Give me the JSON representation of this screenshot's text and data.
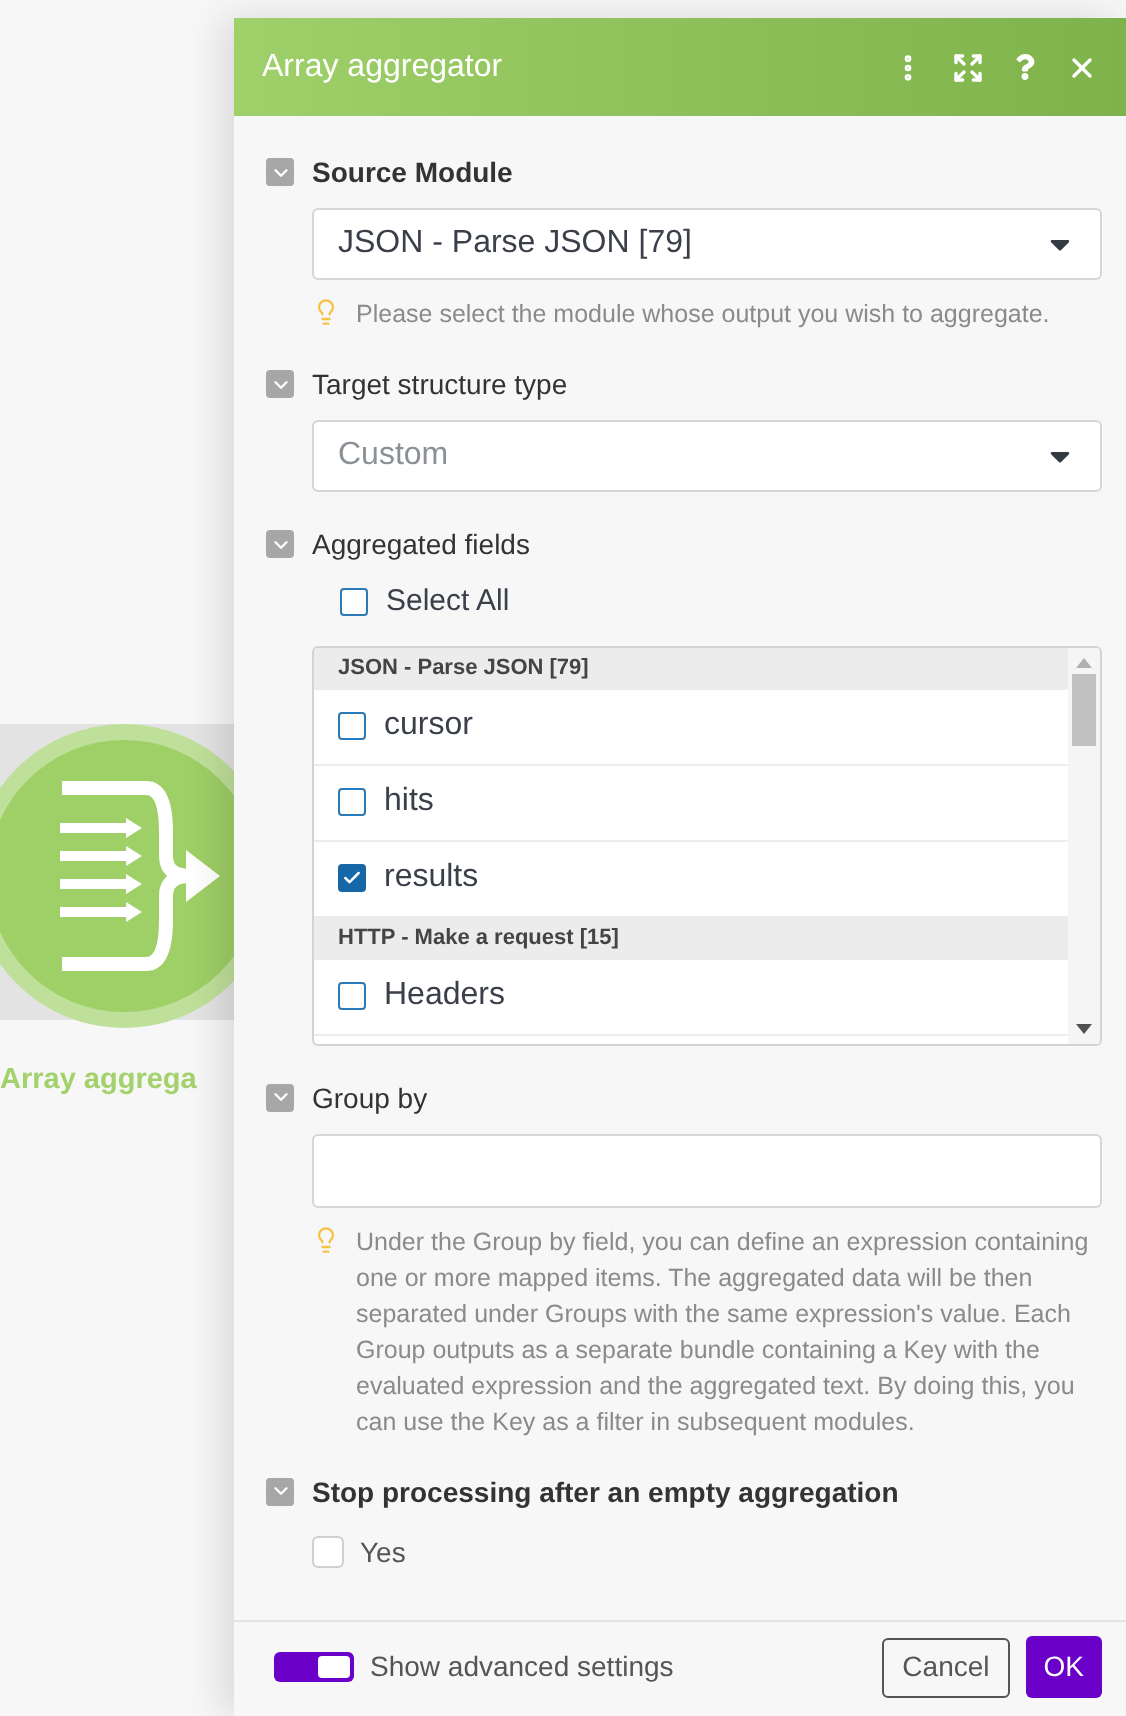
{
  "canvas": {
    "node": {
      "label": "Array aggrega"
    }
  },
  "panel": {
    "title": "Array aggregator",
    "sections": [
      {
        "kind": "select",
        "label": "Source Module",
        "required": true,
        "value": "JSON - Parse JSON [79]",
        "hint": "Please select the module whose output you wish to aggregate."
      },
      {
        "kind": "select",
        "label": "Target structure type",
        "required": false,
        "placeholder": "Custom"
      },
      {
        "kind": "checklist",
        "label": "Aggregated fields",
        "required": false,
        "select_all": {
          "label": "Select All",
          "checked": false
        },
        "groups": [
          {
            "title": "JSON - Parse JSON [79]",
            "items": [
              {
                "label": "cursor",
                "checked": false
              },
              {
                "label": "hits",
                "checked": false
              },
              {
                "label": "results",
                "checked": true
              }
            ]
          },
          {
            "title": "HTTP - Make a request [15]",
            "items": [
              {
                "label": "Headers",
                "checked": false
              }
            ]
          }
        ]
      },
      {
        "kind": "text",
        "label": "Group by",
        "required": false,
        "hint": "Under the Group by field, you can define an expression containing one or more mapped items. The aggregated data will be then separated under Groups with the same expression's value. Each Group outputs as a separate bundle containing a Key with the evaluated expression and the aggregated text. By doing this, you can use the Key as a filter in subsequent modules."
      },
      {
        "kind": "checkbox",
        "label": "Stop processing after an empty aggregation",
        "required": true,
        "option": {
          "label": "Yes",
          "checked": false
        }
      }
    ],
    "footer": {
      "advanced": {
        "label": "Show advanced settings",
        "on": true
      },
      "cancel": "Cancel",
      "ok": "OK"
    }
  }
}
